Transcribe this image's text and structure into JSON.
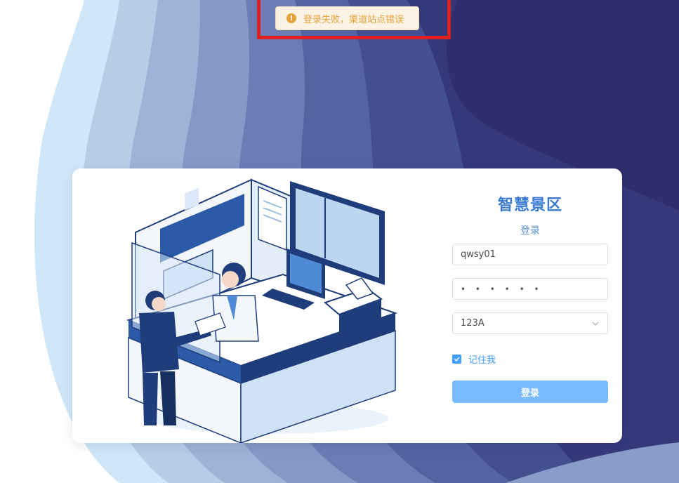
{
  "colors": {
    "accent": "#409eff",
    "title": "#3a7bd5",
    "warning": "#e6a23c",
    "highlight_border": "#e0201c",
    "background_dark": "#2f2f6e"
  },
  "toast": {
    "icon": "warning-icon",
    "message": "登录失败，渠道站点错误"
  },
  "login": {
    "app_title": "智慧景区",
    "subtitle": "登录",
    "username_value": "qwsy01",
    "password_mask": "• • • • • •",
    "site_value": "123A",
    "remember_label": "记住我",
    "remember_checked": true,
    "submit_label": "登录"
  }
}
